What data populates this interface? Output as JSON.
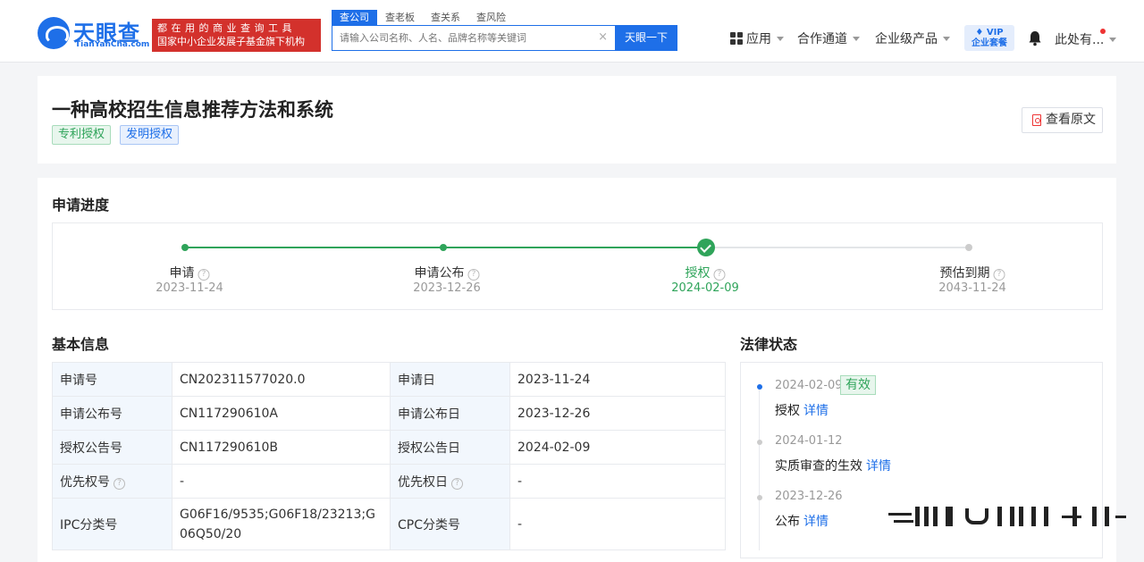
{
  "header": {
    "logo_cn": "天眼查",
    "logo_en": "TianYanCha.com",
    "slogan_line1": "都在用的商业查询工具",
    "slogan_line2": "国家中小企业发展子基金旗下机构",
    "search_tabs": [
      {
        "label": "查公司",
        "active": true
      },
      {
        "label": "查老板",
        "active": false
      },
      {
        "label": "查关系",
        "active": false
      },
      {
        "label": "查风险",
        "active": false
      }
    ],
    "search_placeholder": "请输入公司名称、人名、品牌名称等关键词",
    "search_clear": "×",
    "search_button": "天眼一下",
    "nav_apps": "应用",
    "nav_partner": "合作通道",
    "nav_enterprise": "企业级产品",
    "vip_line1": "VIP",
    "vip_line2": "企业套餐",
    "user_name": "此处有..."
  },
  "patent": {
    "title": "一种高校招生信息推荐方法和系统",
    "tags": [
      "专利授权",
      "发明授权"
    ],
    "view_original": "查看原文"
  },
  "progress": {
    "title": "申请进度",
    "steps": [
      {
        "label": "申请",
        "date": "2023-11-24",
        "status": "done"
      },
      {
        "label": "申请公布",
        "date": "2023-12-26",
        "status": "done"
      },
      {
        "label": "授权",
        "date": "2024-02-09",
        "status": "current"
      },
      {
        "label": "预估到期",
        "date": "2043-11-24",
        "status": "future"
      }
    ],
    "help_glyph": "?"
  },
  "basic_info": {
    "title": "基本信息",
    "rows": [
      {
        "k1": "申请号",
        "v1": "CN202311577020.0",
        "k2": "申请日",
        "v2": "2023-11-24"
      },
      {
        "k1": "申请公布号",
        "v1": "CN117290610A",
        "k2": "申请公布日",
        "v2": "2023-12-26"
      },
      {
        "k1": "授权公告号",
        "v1": "CN117290610B",
        "k2": "授权公告日",
        "v2": "2024-02-09"
      },
      {
        "k1": "优先权号",
        "v1": "-",
        "k2": "优先权日",
        "v2": "-"
      },
      {
        "k1": "IPC分类号",
        "v1": "G06F16/9535;G06F18/23213;G06Q50/20",
        "k2": "CPC分类号",
        "v2": "-"
      }
    ]
  },
  "legal_status": {
    "title": "法律状态",
    "items": [
      {
        "date": "2024-02-09",
        "status": "有效",
        "text": "授权",
        "link": "详情",
        "active": true
      },
      {
        "date": "2024-01-12",
        "status": "",
        "text": "实质审查的生效",
        "link": "详情",
        "active": false
      },
      {
        "date": "2023-12-26",
        "status": "",
        "text": "公布",
        "link": "详情",
        "active": false
      }
    ]
  },
  "colors": {
    "brand": "#1e6fe8",
    "success": "#2fa45a",
    "slogan_bg": "#d3312c"
  }
}
